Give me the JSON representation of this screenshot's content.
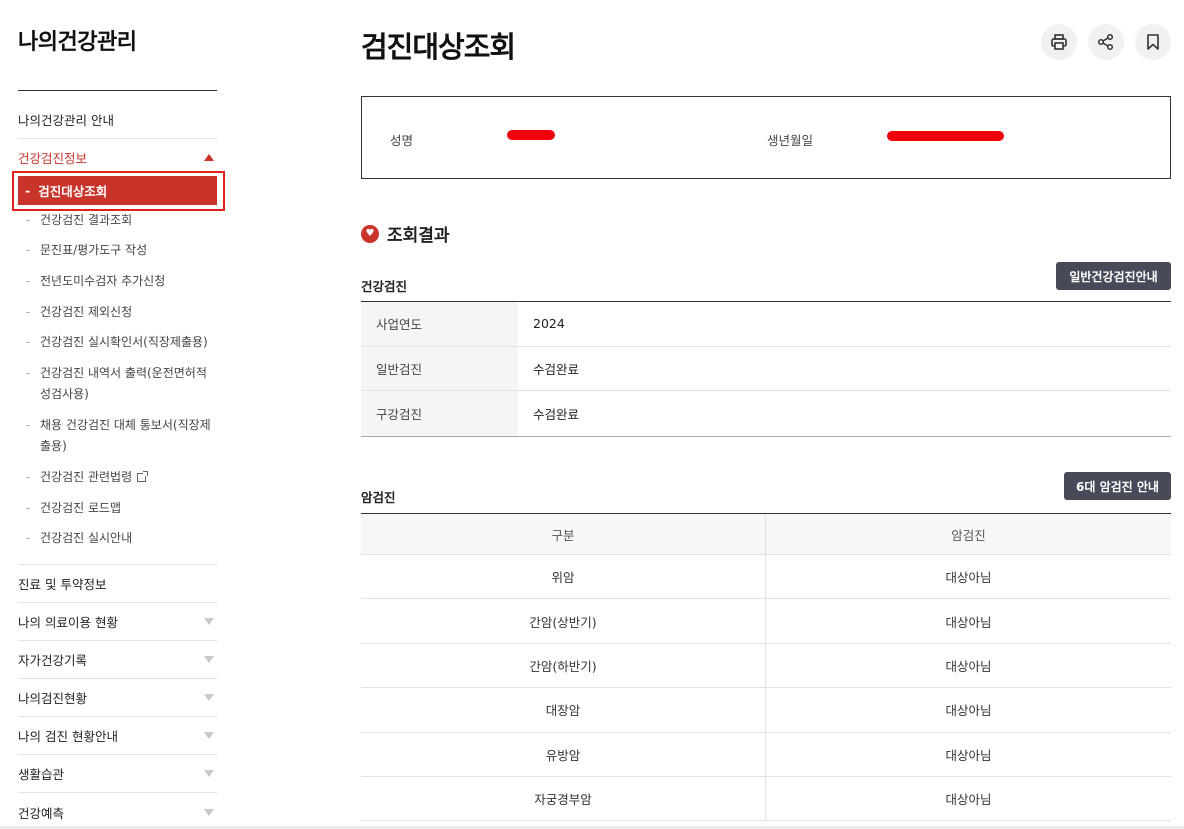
{
  "sidebar": {
    "title": "나의건강관리",
    "menu": [
      {
        "label": "나의건강관리 안내"
      },
      {
        "label": "건강검진정보"
      }
    ],
    "current_sub": "검진대상조회",
    "sub_items": [
      {
        "label": "건강검진 결과조회"
      },
      {
        "label": "문진표/평가도구 작성"
      },
      {
        "label": "전년도미수검자 추가신청"
      },
      {
        "label": "건강검진 제외신청"
      },
      {
        "label": "건강검진 실시확인서(직장제출용)"
      },
      {
        "label": "건강검진 내역서 출력(운전면허적성검사용)"
      },
      {
        "label": "채용 건강검진 대체 통보서(직장제출용)"
      },
      {
        "label": "건강검진 관련법령"
      },
      {
        "label": "건강검진 로드맵"
      },
      {
        "label": "건강검진 실시안내"
      }
    ],
    "lower_menu": [
      {
        "label": "진료 및 투약정보"
      },
      {
        "label": "나의 의료이용 현황"
      },
      {
        "label": "자가건강기록"
      },
      {
        "label": "나의검진현황"
      },
      {
        "label": "나의 검진 현황안내"
      },
      {
        "label": "생활습관"
      },
      {
        "label": "건강예측"
      }
    ]
  },
  "main": {
    "title": "검진대상조회",
    "icons": [
      "print-icon",
      "share-icon",
      "bookmark-icon"
    ],
    "info": {
      "name_label": "성명",
      "birth_label": "생년월일"
    },
    "section_title": "조회결과",
    "health": {
      "title": "건강검진",
      "button": "일반건강검진안내",
      "rows": [
        {
          "key": "사업연도",
          "value": "2024"
        },
        {
          "key": "일반검진",
          "value": "수검완료"
        },
        {
          "key": "구강검진",
          "value": "수검완료"
        }
      ]
    },
    "cancer": {
      "title": "암검진",
      "button": "6대 암검진 안내",
      "headers": [
        "구분",
        "암검진"
      ],
      "rows": [
        {
          "type": "위암",
          "status": "대상아님"
        },
        {
          "type": "간암(상반기)",
          "status": "대상아님"
        },
        {
          "type": "간암(하반기)",
          "status": "대상아님"
        },
        {
          "type": "대장암",
          "status": "대상아님"
        },
        {
          "type": "유방암",
          "status": "대상아님"
        },
        {
          "type": "자궁경부암",
          "status": "대상아님"
        }
      ]
    }
  },
  "colors": {
    "accent": "#c8332a",
    "dark_button": "#474b59",
    "redaction": "#f0000a"
  }
}
